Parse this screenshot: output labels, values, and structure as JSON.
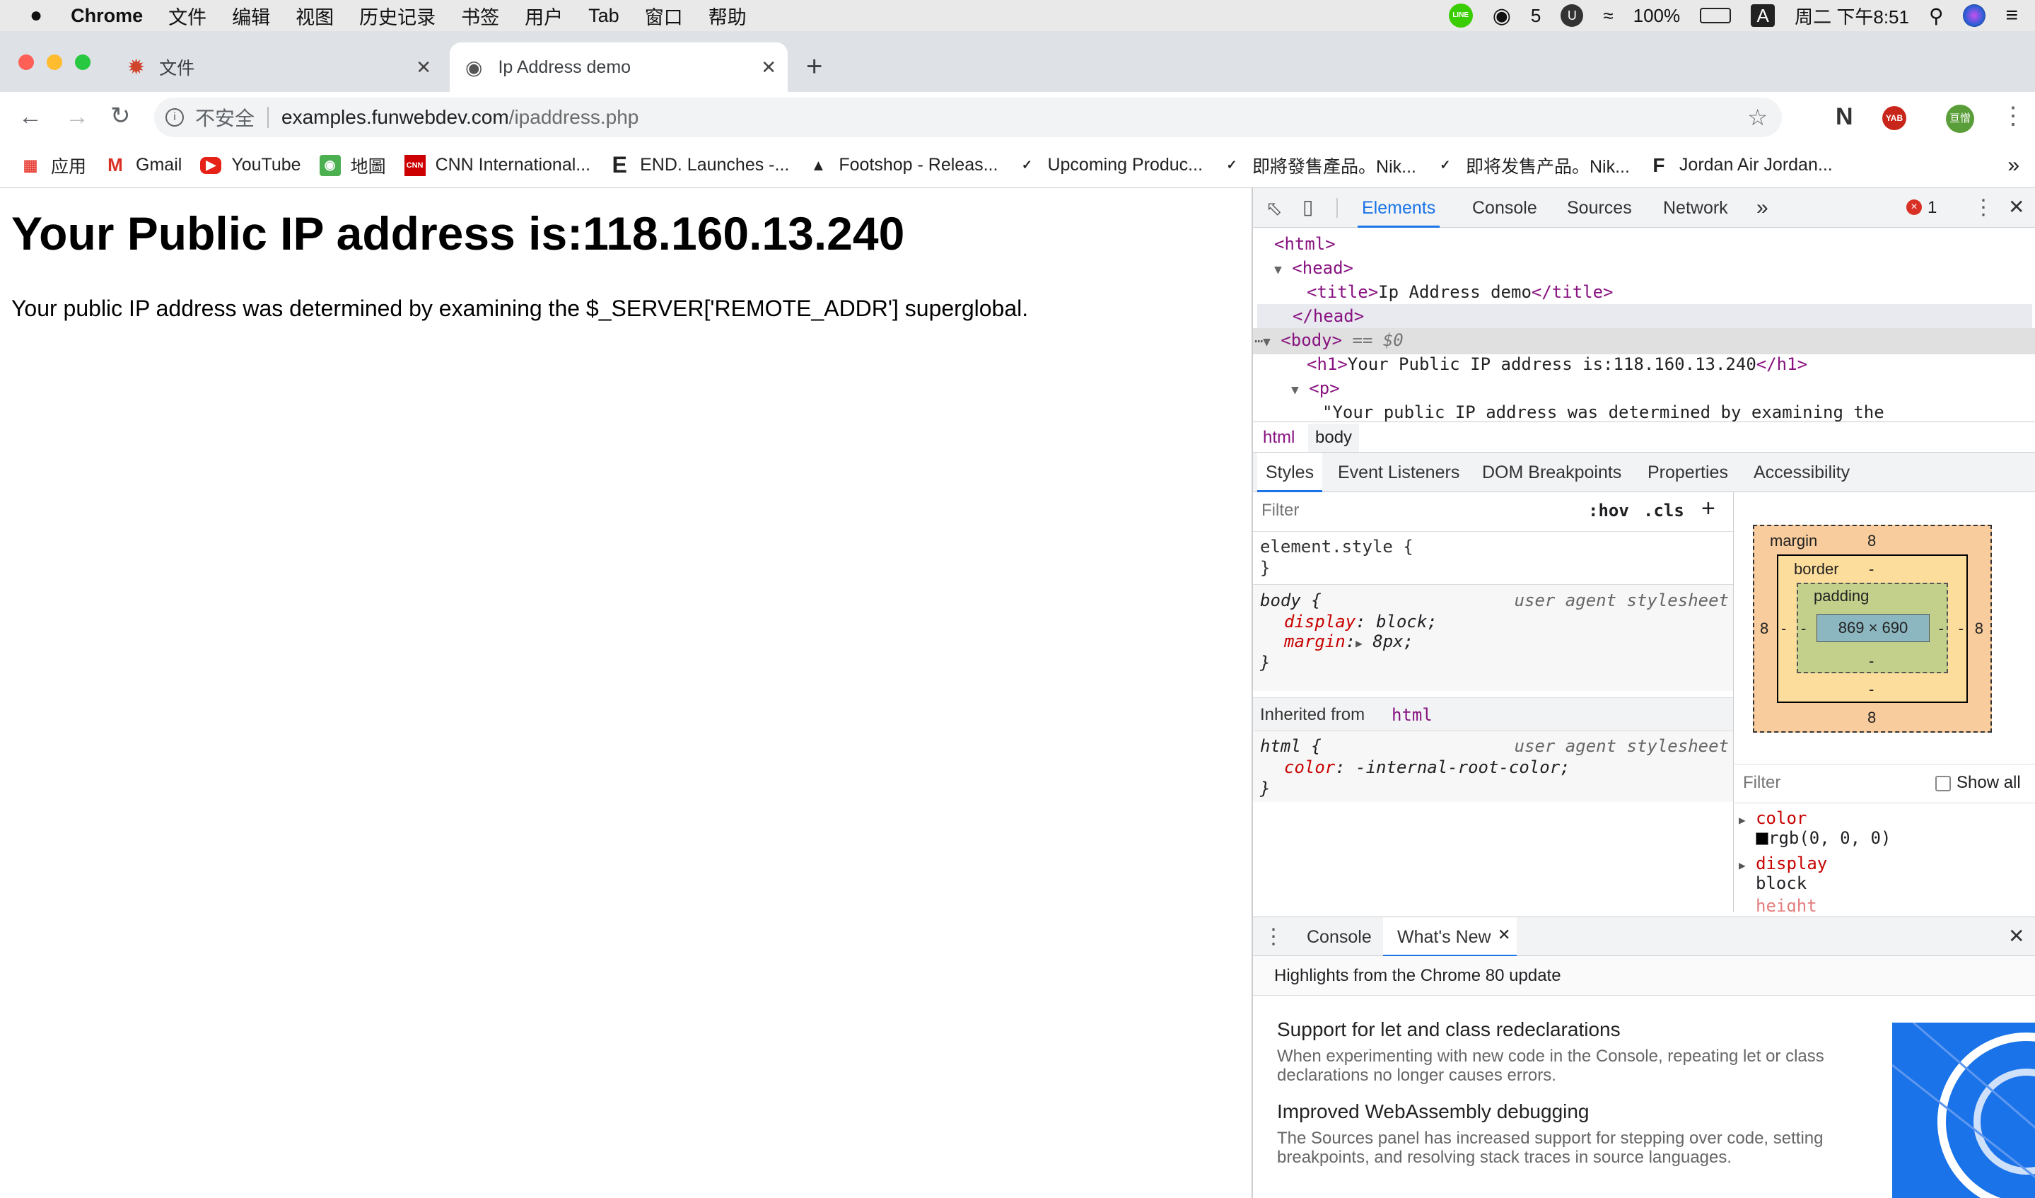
{
  "menubar": {
    "app": "Chrome",
    "items": [
      "文件",
      "编辑",
      "视图",
      "历史记录",
      "书签",
      "用户",
      "Tab",
      "窗口",
      "帮助"
    ],
    "wechat_count": "5",
    "battery": "100%",
    "input_method": "A",
    "clock": "周二 下午8:51"
  },
  "tabs": [
    {
      "title": "文件"
    },
    {
      "title": "Ip Address demo"
    }
  ],
  "omnibox": {
    "security": "不安全",
    "host": "examples.funwebdev.com",
    "path": "/ipaddress.php"
  },
  "profile_badge": "亘憎",
  "ext_badge": "YAB",
  "bookmarks": [
    "应用",
    "Gmail",
    "YouTube",
    "地圖",
    "CNN International...",
    "END. Launches -...",
    "Footshop - Releas...",
    "Upcoming Produc...",
    "即將發售產品。Nik...",
    "即将发售产品。Nik...",
    "Jordan Air Jordan..."
  ],
  "page": {
    "heading": "Your Public IP address is:118.160.13.240",
    "paragraph": "Your public IP address was determined by examining the $_SERVER['REMOTE_ADDR'] superglobal."
  },
  "devtools": {
    "tabs": [
      "Elements",
      "Console",
      "Sources",
      "Network"
    ],
    "error_count": "1",
    "dom": {
      "html_open": "<html>",
      "head_open": "<head>",
      "title_line_open": "<title>",
      "title_text": "Ip Address demo",
      "title_line_close": "</title>",
      "head_close": "</head>",
      "body_open": "<body>",
      "body_marker": "== $0",
      "h1_open": "<h1>",
      "h1_text": "Your Public IP address is:118.160.13.240",
      "h1_close": "</h1>",
      "p_open": "<p>",
      "p_text": "\"Your public IP address was determined by examining the"
    },
    "breadcrumb": [
      "html",
      "body"
    ],
    "sub_tabs": [
      "Styles",
      "Event Listeners",
      "DOM Breakpoints",
      "Properties",
      "Accessibility"
    ],
    "styles": {
      "filter_placeholder": "Filter",
      "hov": ":hov",
      "cls": ".cls",
      "element_style": "element.style {",
      "close_brace": "}",
      "body_selector": "body {",
      "ua_label": "user agent stylesheet",
      "body_rule1_prop": "display",
      "body_rule1_val": "block;",
      "body_rule2_prop": "margin",
      "body_rule2_val": "8px;",
      "inherited_label": "Inherited from",
      "inherited_tag": "html",
      "html_selector": "html {",
      "html_rule_prop": "color",
      "html_rule_val": "-internal-root-color;"
    },
    "box_model": {
      "margin_label": "margin",
      "margin_top": "8",
      "margin_left": "8",
      "margin_right": "8",
      "margin_bottom": "8",
      "border_label": "border",
      "border_val": "-",
      "padding_label": "padding",
      "padding_val": "-",
      "content": "869 × 690"
    },
    "computed": {
      "filter_placeholder": "Filter",
      "show_all": "Show all",
      "props": [
        {
          "name": "color",
          "value": "rgb(0, 0, 0)"
        },
        {
          "name": "display",
          "value": "block"
        },
        {
          "name": "height",
          "value": ""
        }
      ]
    },
    "drawer": {
      "tabs": [
        "Console",
        "What's New"
      ],
      "highlights": "Highlights from the Chrome 80 update",
      "items": [
        {
          "title": "Support for let and class redeclarations",
          "body": "When experimenting with new code in the Console, repeating let or class declarations no longer causes errors."
        },
        {
          "title": "Improved WebAssembly debugging",
          "body": "The Sources panel has increased support for stepping over code, setting breakpoints, and resolving stack traces in source languages."
        }
      ]
    }
  },
  "colors": {
    "accent": "#1a73e8",
    "margin_box": "#f9cc9d",
    "border_box": "#fddd9b",
    "padding_box": "#c3d08b",
    "content_box": "#8cb6c0"
  }
}
